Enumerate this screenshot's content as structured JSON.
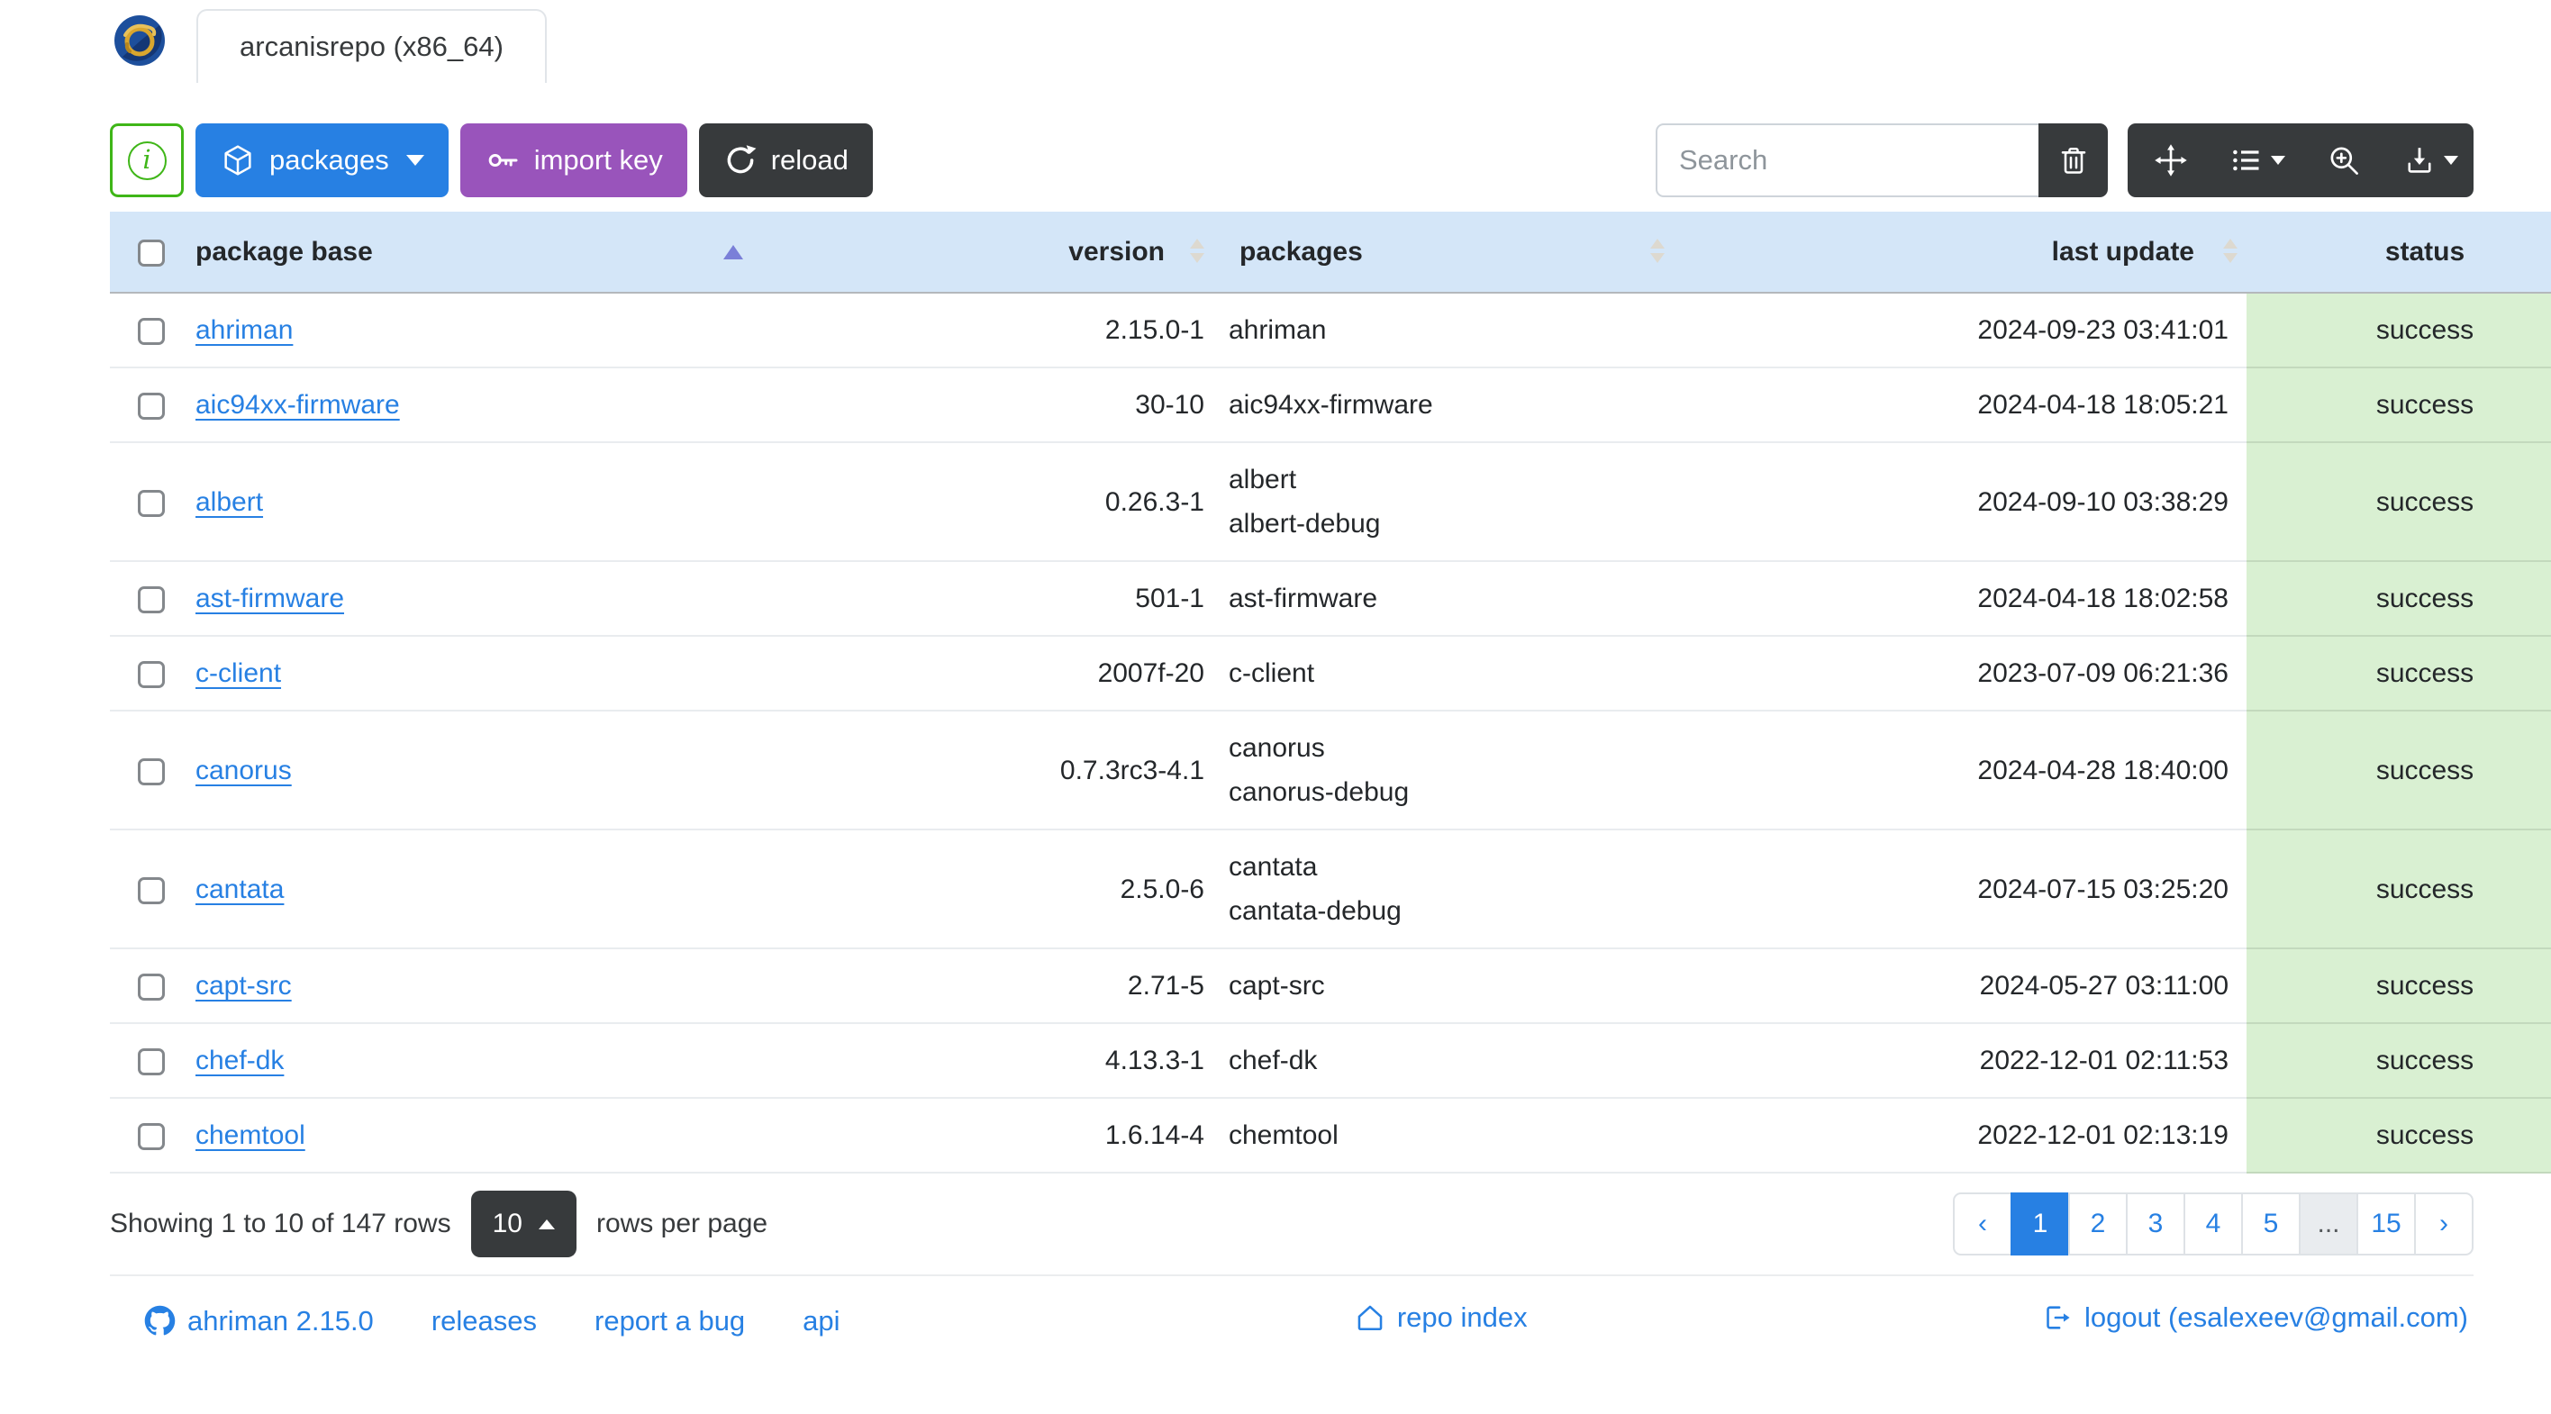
{
  "window": {
    "tab_title": "arcanisrepo (x86_64)"
  },
  "toolbar": {
    "packages_label": "packages",
    "import_key_label": "import key",
    "reload_label": "reload",
    "search_placeholder": "Search",
    "icons": [
      "info-icon",
      "cube-icon",
      "key-icon",
      "reload-icon",
      "trash-icon",
      "arrows-move-icon",
      "list-columns-icon",
      "zoom-in-icon",
      "download-icon"
    ]
  },
  "colors": {
    "primary": "#2780e3",
    "info_purple": "#9954bb",
    "secondary_dark": "#373a3c",
    "success_green": "#3fb618",
    "table_header_bg": "#d4e6f8",
    "status_success_bg": "#d9f0d2",
    "sort_active": "#7a7fd8",
    "link": "#2780e3"
  },
  "table": {
    "columns": [
      {
        "label": "package base",
        "sort": "asc"
      },
      {
        "label": "version",
        "sort": "none"
      },
      {
        "label": "packages",
        "sort": "none"
      },
      {
        "label": "last update",
        "sort": "none"
      },
      {
        "label": "status",
        "sort": "none"
      }
    ],
    "rows": [
      {
        "package_base": "ahriman",
        "version": "2.15.0-1",
        "packages": [
          "ahriman"
        ],
        "last_update": "2024-09-23 03:41:01",
        "status": "success"
      },
      {
        "package_base": "aic94xx-firmware",
        "version": "30-10",
        "packages": [
          "aic94xx-firmware"
        ],
        "last_update": "2024-04-18 18:05:21",
        "status": "success"
      },
      {
        "package_base": "albert",
        "version": "0.26.3-1",
        "packages": [
          "albert",
          "albert-debug"
        ],
        "last_update": "2024-09-10 03:38:29",
        "status": "success"
      },
      {
        "package_base": "ast-firmware",
        "version": "501-1",
        "packages": [
          "ast-firmware"
        ],
        "last_update": "2024-04-18 18:02:58",
        "status": "success"
      },
      {
        "package_base": "c-client",
        "version": "2007f-20",
        "packages": [
          "c-client"
        ],
        "last_update": "2023-07-09 06:21:36",
        "status": "success"
      },
      {
        "package_base": "canorus",
        "version": "0.7.3rc3-4.1",
        "packages": [
          "canorus",
          "canorus-debug"
        ],
        "last_update": "2024-04-28 18:40:00",
        "status": "success"
      },
      {
        "package_base": "cantata",
        "version": "2.5.0-6",
        "packages": [
          "cantata",
          "cantata-debug"
        ],
        "last_update": "2024-07-15 03:25:20",
        "status": "success"
      },
      {
        "package_base": "capt-src",
        "version": "2.71-5",
        "packages": [
          "capt-src"
        ],
        "last_update": "2024-05-27 03:11:00",
        "status": "success"
      },
      {
        "package_base": "chef-dk",
        "version": "4.13.3-1",
        "packages": [
          "chef-dk"
        ],
        "last_update": "2022-12-01 02:11:53",
        "status": "success"
      },
      {
        "package_base": "chemtool",
        "version": "1.6.14-4",
        "packages": [
          "chemtool"
        ],
        "last_update": "2022-12-01 02:13:19",
        "status": "success"
      }
    ]
  },
  "pagination": {
    "summary": "Showing 1 to 10 of 147 rows",
    "page_size": "10",
    "rows_per_page_label": "rows per page",
    "prev": "‹",
    "pages": [
      "1",
      "2",
      "3",
      "4",
      "5",
      "...",
      "15"
    ],
    "next": "›",
    "active_page": "1"
  },
  "footer": {
    "github_label": "ahriman 2.15.0",
    "releases_label": "releases",
    "report_bug_label": "report a bug",
    "api_label": "api",
    "repo_index_label": "repo index",
    "logout_label": "logout (esalexeev@gmail.com)"
  }
}
